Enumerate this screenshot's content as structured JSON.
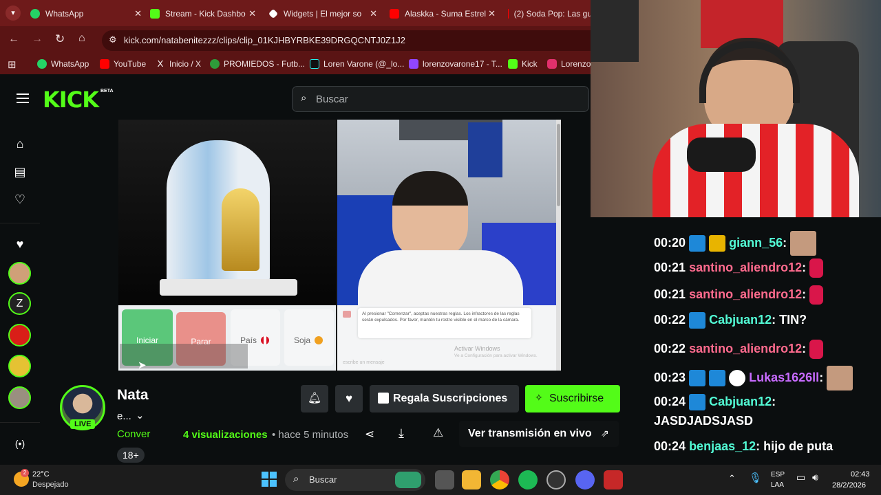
{
  "browser": {
    "tabs": [
      {
        "label": "WhatsApp",
        "color": "#25d366"
      },
      {
        "label": "Stream - Kick Dashbo",
        "color": "#53fc18"
      },
      {
        "label": "Widgets | El mejor so",
        "color": "#ffffff"
      },
      {
        "label": "Alaskka - Suma Estrel",
        "color": "#ff0000"
      },
      {
        "label": "(2) Soda Pop: Las gu",
        "color": "#ff0000"
      }
    ],
    "url": "kick.com/natabenitezzz/clips/clip_01KJHBYRBKE39DRGQCNTJ0Z1J2",
    "bookmarks": [
      {
        "label": "WhatsApp",
        "color": "#25d366"
      },
      {
        "label": "YouTube",
        "color": "#ff0000"
      },
      {
        "label": "Inicio / X",
        "color": "#ffffff"
      },
      {
        "label": "PROMIEDOS - Futb...",
        "color": "#2e9b3a"
      },
      {
        "label": "Loren Varone (@_lo...",
        "color": "#000000"
      },
      {
        "label": "lorenzovarone17 - T...",
        "color": "#9146ff"
      },
      {
        "label": "Kick",
        "color": "#53fc18"
      },
      {
        "label": "Lorenzo",
        "color": "#e1306c"
      }
    ]
  },
  "kick": {
    "logo": "KICK",
    "logo_badge": "BETA",
    "search_placeholder": "Buscar",
    "accent": "#53fc18"
  },
  "video": {
    "buttons": {
      "start": "Iniciar",
      "stop": "Parar",
      "country": "País",
      "soja": "Soja"
    },
    "notice": "Al presionar \"Comenzar\", aceptas nuestras reglas. Los infractores de las reglas serán expulsados. Por favor, mantén tu rostro visible en el marco de la cámara.",
    "windows_activate": "Activar Windows",
    "windows_activate_sub": "Ve a Configuración para activar Windows.",
    "chat_placeholder": "escribe un mensaje"
  },
  "channel": {
    "name": "Nata",
    "subtitle": "e...",
    "live_badge": "LIVE",
    "clip_title": "Conver",
    "views": "4 visualizaciones",
    "time_ago": "• hace 5 minutos",
    "age_badge": "18+",
    "gift_button": "Regala Suscripciones",
    "subscribe_button": "Suscribirse",
    "watch_live": "Ver transmisión en vivo"
  },
  "chat": {
    "messages": [
      {
        "time": "00:20",
        "user": "giann_56",
        "user_color": "#53fcd6",
        "text": ""
      },
      {
        "time": "00:21",
        "user": "santino_aliendro12",
        "user_color": "#ff6b8e",
        "text": ""
      },
      {
        "time": "00:21",
        "user": "santino_aliendro12",
        "user_color": "#ff6b8e",
        "text": ""
      },
      {
        "time": "00:22",
        "user": "Cabjuan12",
        "user_color": "#53fcd6",
        "text": "TIN?"
      },
      {
        "time": "00:22",
        "user": "santino_aliendro12",
        "user_color": "#ff6b8e",
        "text": ""
      },
      {
        "time": "00:23",
        "user": "Lukas1626ll",
        "user_color": "#c86bff",
        "text": ""
      },
      {
        "time": "00:24",
        "user": "Cabjuan12",
        "user_color": "#53fcd6",
        "text": "JASDJADSJASD"
      },
      {
        "time": "00:24",
        "user": "benjaas_12",
        "user_color": "#53fcd6",
        "text": "hijo de puta"
      }
    ]
  },
  "taskbar": {
    "weather_temp": "22°C",
    "weather_desc": "Despejado",
    "weather_badge": "2",
    "search": "Buscar",
    "lang": "ESP",
    "lang_sub": "LAA",
    "time": "02:43",
    "date": "28/2/2026"
  }
}
